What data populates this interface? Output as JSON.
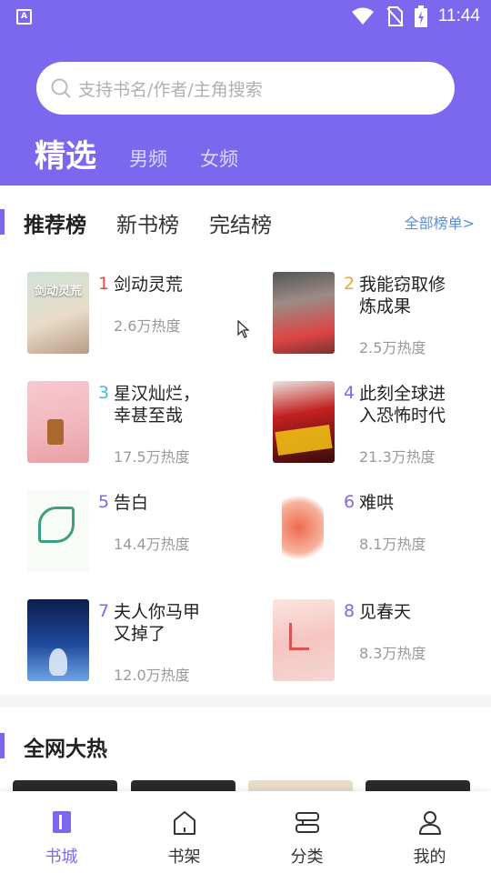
{
  "colors": {
    "accent": "#7b68ee",
    "link": "#5a8de0"
  },
  "status_bar": {
    "time": "11:44",
    "app_icon_letter": "A"
  },
  "search": {
    "placeholder": "支持书名/作者/主角搜索"
  },
  "tabs": [
    {
      "label": "精选",
      "active": true
    },
    {
      "label": "男频",
      "active": false
    },
    {
      "label": "女频",
      "active": false
    }
  ],
  "rank_tabs": [
    {
      "label": "推荐榜",
      "active": true
    },
    {
      "label": "新书榜",
      "active": false
    },
    {
      "label": "完结榜",
      "active": false
    }
  ],
  "rank_all_link": "全部榜单>",
  "books": [
    {
      "rank": "1",
      "title": "剑动灵荒",
      "heat": "2.6万热度",
      "rank_color": "#e84545",
      "cover_text": "剑动灵荒"
    },
    {
      "rank": "2",
      "title": "我能窃取修炼成果",
      "heat": "2.5万热度",
      "rank_color": "#f5a623",
      "cover_text": ""
    },
    {
      "rank": "3",
      "title": "星汉灿烂，幸甚至哉",
      "heat": "17.5万热度",
      "rank_color": "#35c0d8",
      "cover_text": ""
    },
    {
      "rank": "4",
      "title": "此刻全球进入恐怖时代",
      "heat": "21.3万热度",
      "rank_color": "#7b68ee",
      "cover_text": ""
    },
    {
      "rank": "5",
      "title": "告白",
      "heat": "14.4万热度",
      "rank_color": "#7b68ee",
      "cover_text": ""
    },
    {
      "rank": "6",
      "title": "难哄",
      "heat": "8.1万热度",
      "rank_color": "#7b68ee",
      "cover_text": ""
    },
    {
      "rank": "7",
      "title": "夫人你马甲又掉了",
      "heat": "12.0万热度",
      "rank_color": "#7b68ee",
      "cover_text": ""
    },
    {
      "rank": "8",
      "title": "见春天",
      "heat": "8.3万热度",
      "rank_color": "#7b68ee",
      "cover_text": ""
    }
  ],
  "hot_section": {
    "title": "全网大热"
  },
  "bottom_nav": [
    {
      "label": "书城",
      "icon": "bookstore-icon",
      "active": true
    },
    {
      "label": "书架",
      "icon": "bookshelf-icon",
      "active": false
    },
    {
      "label": "分类",
      "icon": "category-icon",
      "active": false
    },
    {
      "label": "我的",
      "icon": "profile-icon",
      "active": false
    }
  ]
}
